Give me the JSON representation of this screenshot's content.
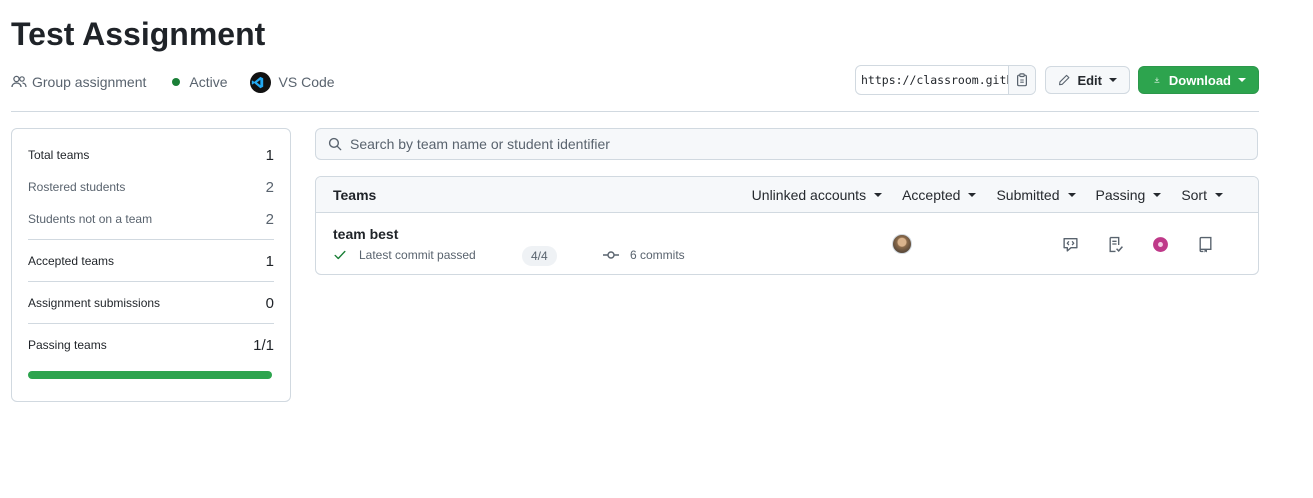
{
  "page": {
    "title": "Test Assignment"
  },
  "meta": {
    "type_label": "Group assignment",
    "type_icon": "people-icon",
    "status_label": "Active",
    "status_color": "#1a7f37",
    "editor_label": "VS Code",
    "editor_icon": "vscode-icon"
  },
  "actions": {
    "invite_url": "https://classroom.github.com/a/",
    "copy_icon": "clipboard-icon",
    "edit_label": "Edit",
    "download_label": "Download",
    "download_color": "#2da44e"
  },
  "stats": {
    "total_teams_label": "Total teams",
    "total_teams_value": "1",
    "rostered_label": "Rostered students",
    "rostered_value": "2",
    "not_on_team_label": "Students not on a team",
    "not_on_team_value": "2",
    "accepted_label": "Accepted teams",
    "accepted_value": "1",
    "submissions_label": "Assignment submissions",
    "submissions_value": "0",
    "passing_label": "Passing teams",
    "passing_value": "1/1",
    "passing_fraction": 1.0
  },
  "search": {
    "placeholder": "Search by team name or student identifier"
  },
  "table": {
    "header": "Teams",
    "filters": [
      "Unlinked accounts",
      "Accepted",
      "Submitted",
      "Passing",
      "Sort"
    ],
    "rows": [
      {
        "team_name": "team best",
        "status_text": "Latest commit passed",
        "tests": "4/4",
        "commits": "6 commits",
        "row_icons": [
          "feedback-icon",
          "grade-icon",
          "submission-status-icon",
          "repository-icon"
        ]
      }
    ]
  }
}
